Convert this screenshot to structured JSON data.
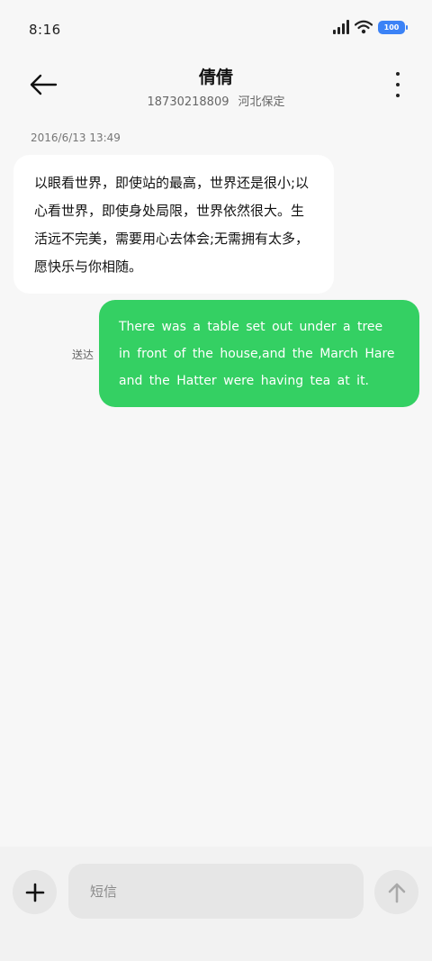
{
  "status_bar": {
    "time": "8:16",
    "battery": "100",
    "icons": [
      "signal-icon",
      "wifi-icon",
      "battery-icon"
    ]
  },
  "header": {
    "contact_name": "倩倩",
    "phone": "18730218809",
    "location": "河北保定",
    "back_icon": "back-arrow-icon",
    "more_icon": "more-vertical-icon"
  },
  "conversation": {
    "timestamp": "2016/6/13 13:49",
    "incoming": {
      "lines": [
        "以眼看世界，即使站的最高，世界还是很小;以",
        "心看世界，即使身处局限，世界依然很大。生",
        "活远不完美，需要用心去体会;无需拥有太多，",
        "愿快乐与你相随。"
      ]
    },
    "outgoing": {
      "lines": [
        "There was a table set out under a tree",
        "in front of the house,and the March Hare",
        "and the Hatter were having tea at it."
      ],
      "status": "送达"
    }
  },
  "composer": {
    "placeholder": "短信",
    "value": "",
    "add_icon": "plus-icon",
    "send_icon": "send-arrow-up-icon"
  },
  "colors": {
    "background": "#f7f7f7",
    "incoming_bubble": "#ffffff",
    "outgoing_bubble": "#34d063",
    "battery": "#3b82f6"
  }
}
